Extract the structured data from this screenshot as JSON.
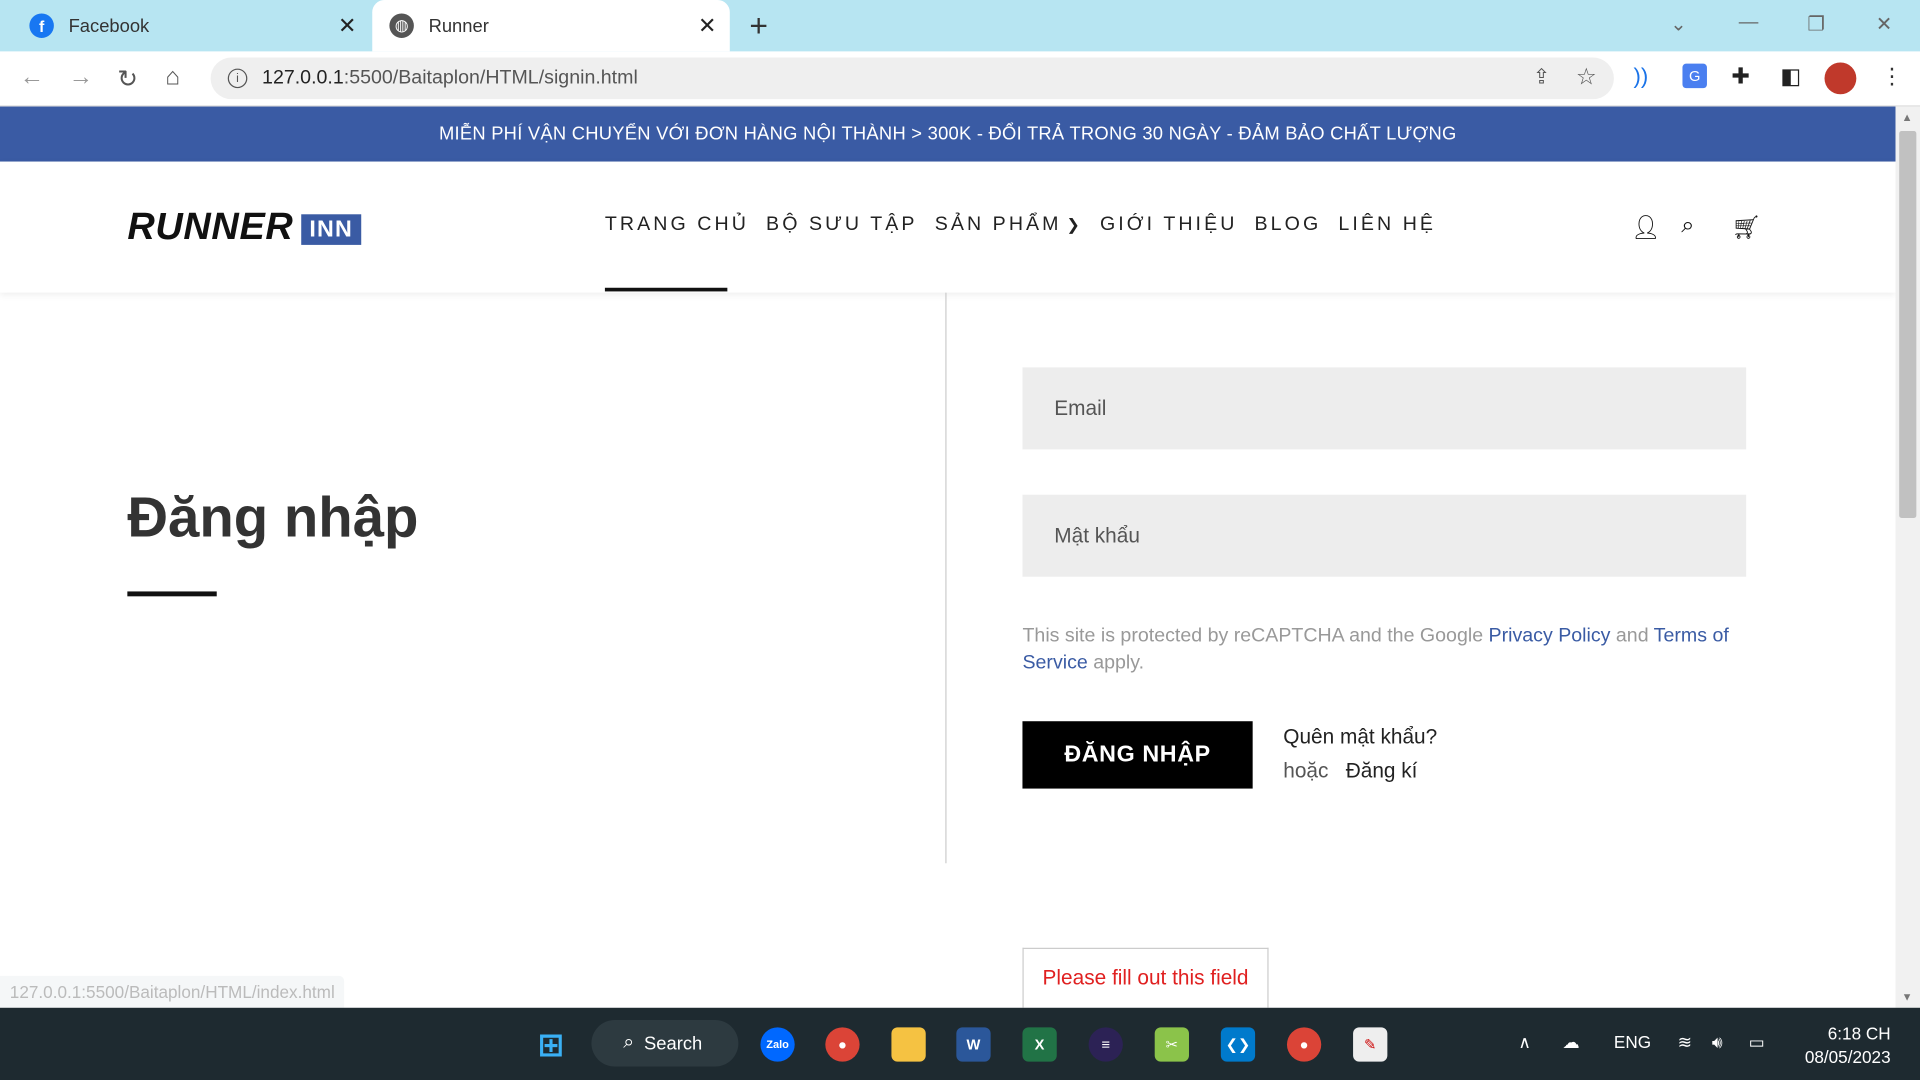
{
  "browser": {
    "tabs": [
      {
        "title": "Facebook",
        "active": false
      },
      {
        "title": "Runner",
        "active": true
      }
    ],
    "url_host": "127.0.0.1",
    "url_path": ":5500/Baitaplon/HTML/signin.html",
    "status_url": "127.0.0.1:5500/Baitaplon/HTML/index.html"
  },
  "site": {
    "announcement": "MIỄN PHÍ VẬN CHUYỂN VỚI ĐƠN HÀNG NỘI THÀNH > 300K - ĐỔI TRẢ TRONG 30 NGÀY - ĐẢM BẢO CHẤT LƯỢNG",
    "logo_main": "RUNNER",
    "logo_badge": "INN",
    "menu": [
      "TRANG CHỦ",
      "BỘ SƯU TẬP",
      "SẢN PHẨM",
      "GIỚI THIỆU",
      "BLOG",
      "LIÊN HỆ"
    ],
    "header_icons": [
      "user-icon",
      "search-icon",
      "cart-icon"
    ]
  },
  "login": {
    "heading": "Đăng nhập",
    "email_placeholder": "Email",
    "password_placeholder": "Mật khẩu",
    "recaptcha_prefix": "This site is protected by reCAPTCHA and the Google ",
    "privacy_link": "Privacy Policy",
    "recaptcha_and": " and ",
    "terms_link": "Terms of Service",
    "recaptcha_suffix": " apply.",
    "submit_label": "ĐĂNG NHẬP",
    "forgot_label": "Quên mật khẩu?",
    "or_label": "hoặc",
    "register_label": "Đăng kí",
    "validation_tooltip": "Please fill out this field"
  },
  "taskbar": {
    "search_label": "Search",
    "language": "ENG",
    "time": "6:18 CH",
    "date": "08/05/2023",
    "apps": [
      "zalo",
      "chrome",
      "file-explorer",
      "word",
      "excel",
      "eclipse",
      "snipping",
      "vscode",
      "chrome-profile",
      "editor"
    ]
  },
  "colors": {
    "accent": "#3a5ba4",
    "tabbar": "#b7e5f2",
    "error": "#e02020"
  }
}
